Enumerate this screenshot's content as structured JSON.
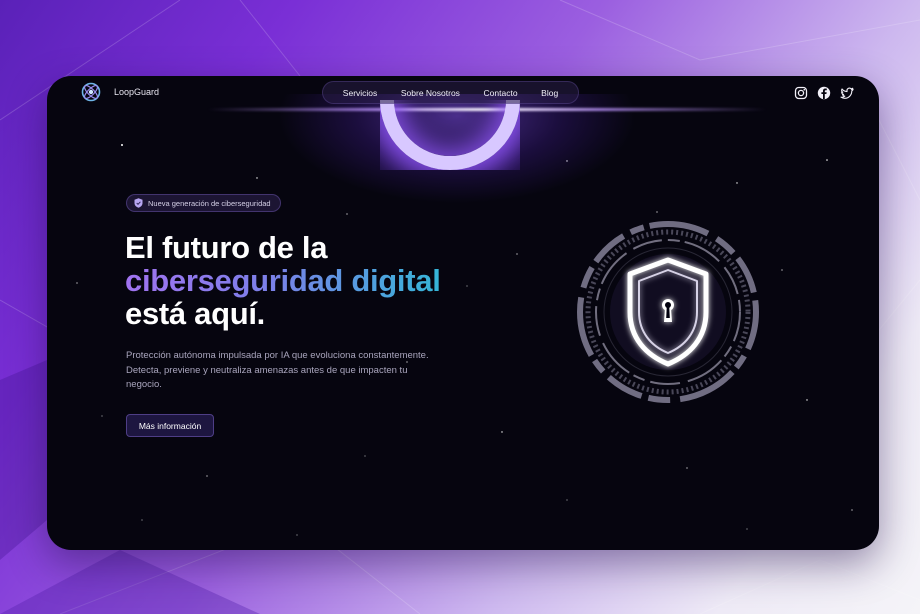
{
  "nav": {
    "brand": "LoopGuard",
    "items": [
      {
        "label": "Servicios"
      },
      {
        "label": "Sobre Nosotros"
      },
      {
        "label": "Contacto"
      },
      {
        "label": "Blog"
      }
    ],
    "social": [
      "instagram-icon",
      "facebook-icon",
      "twitter-icon"
    ]
  },
  "hero": {
    "badge": "Nueva generación de ciberseguridad",
    "title_line1": "El futuro de la",
    "title_line2": "ciberseguridad digital",
    "title_line3": "está aquí.",
    "description": "Protección autónoma impulsada por IA que evoluciona constantemente. Detecta, previene y neutraliza amenazas antes de que impacten tu negocio.",
    "cta": "Más información"
  },
  "colors": {
    "accent_start": "#a173f0",
    "accent_end": "#35b6d8",
    "background": "#06050f",
    "glow": "#9a5cff"
  }
}
